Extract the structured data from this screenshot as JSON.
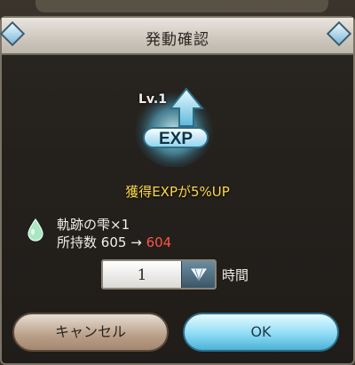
{
  "dialog": {
    "title": "発動確認",
    "level": "Lv.1",
    "exp_label": "EXP",
    "boost_text": "獲得EXPが5%UP",
    "item_name": "軌跡の雫×1",
    "owned_label": "所持数",
    "owned_before": "605",
    "owned_arrow": "→",
    "owned_after": "604",
    "quantity": "1",
    "unit": "時間",
    "cancel_label": "キャンセル",
    "ok_label": "OK"
  },
  "colors": {
    "boost_text": "#ffd84a",
    "owned_after": "#ff5440",
    "ok_button": "#8fdcf5",
    "cancel_button": "#b99f89"
  },
  "icons": [
    "exp-boost-icon",
    "droplet-icon",
    "dropdown-arrow-icon",
    "corner-gem-icon"
  ]
}
